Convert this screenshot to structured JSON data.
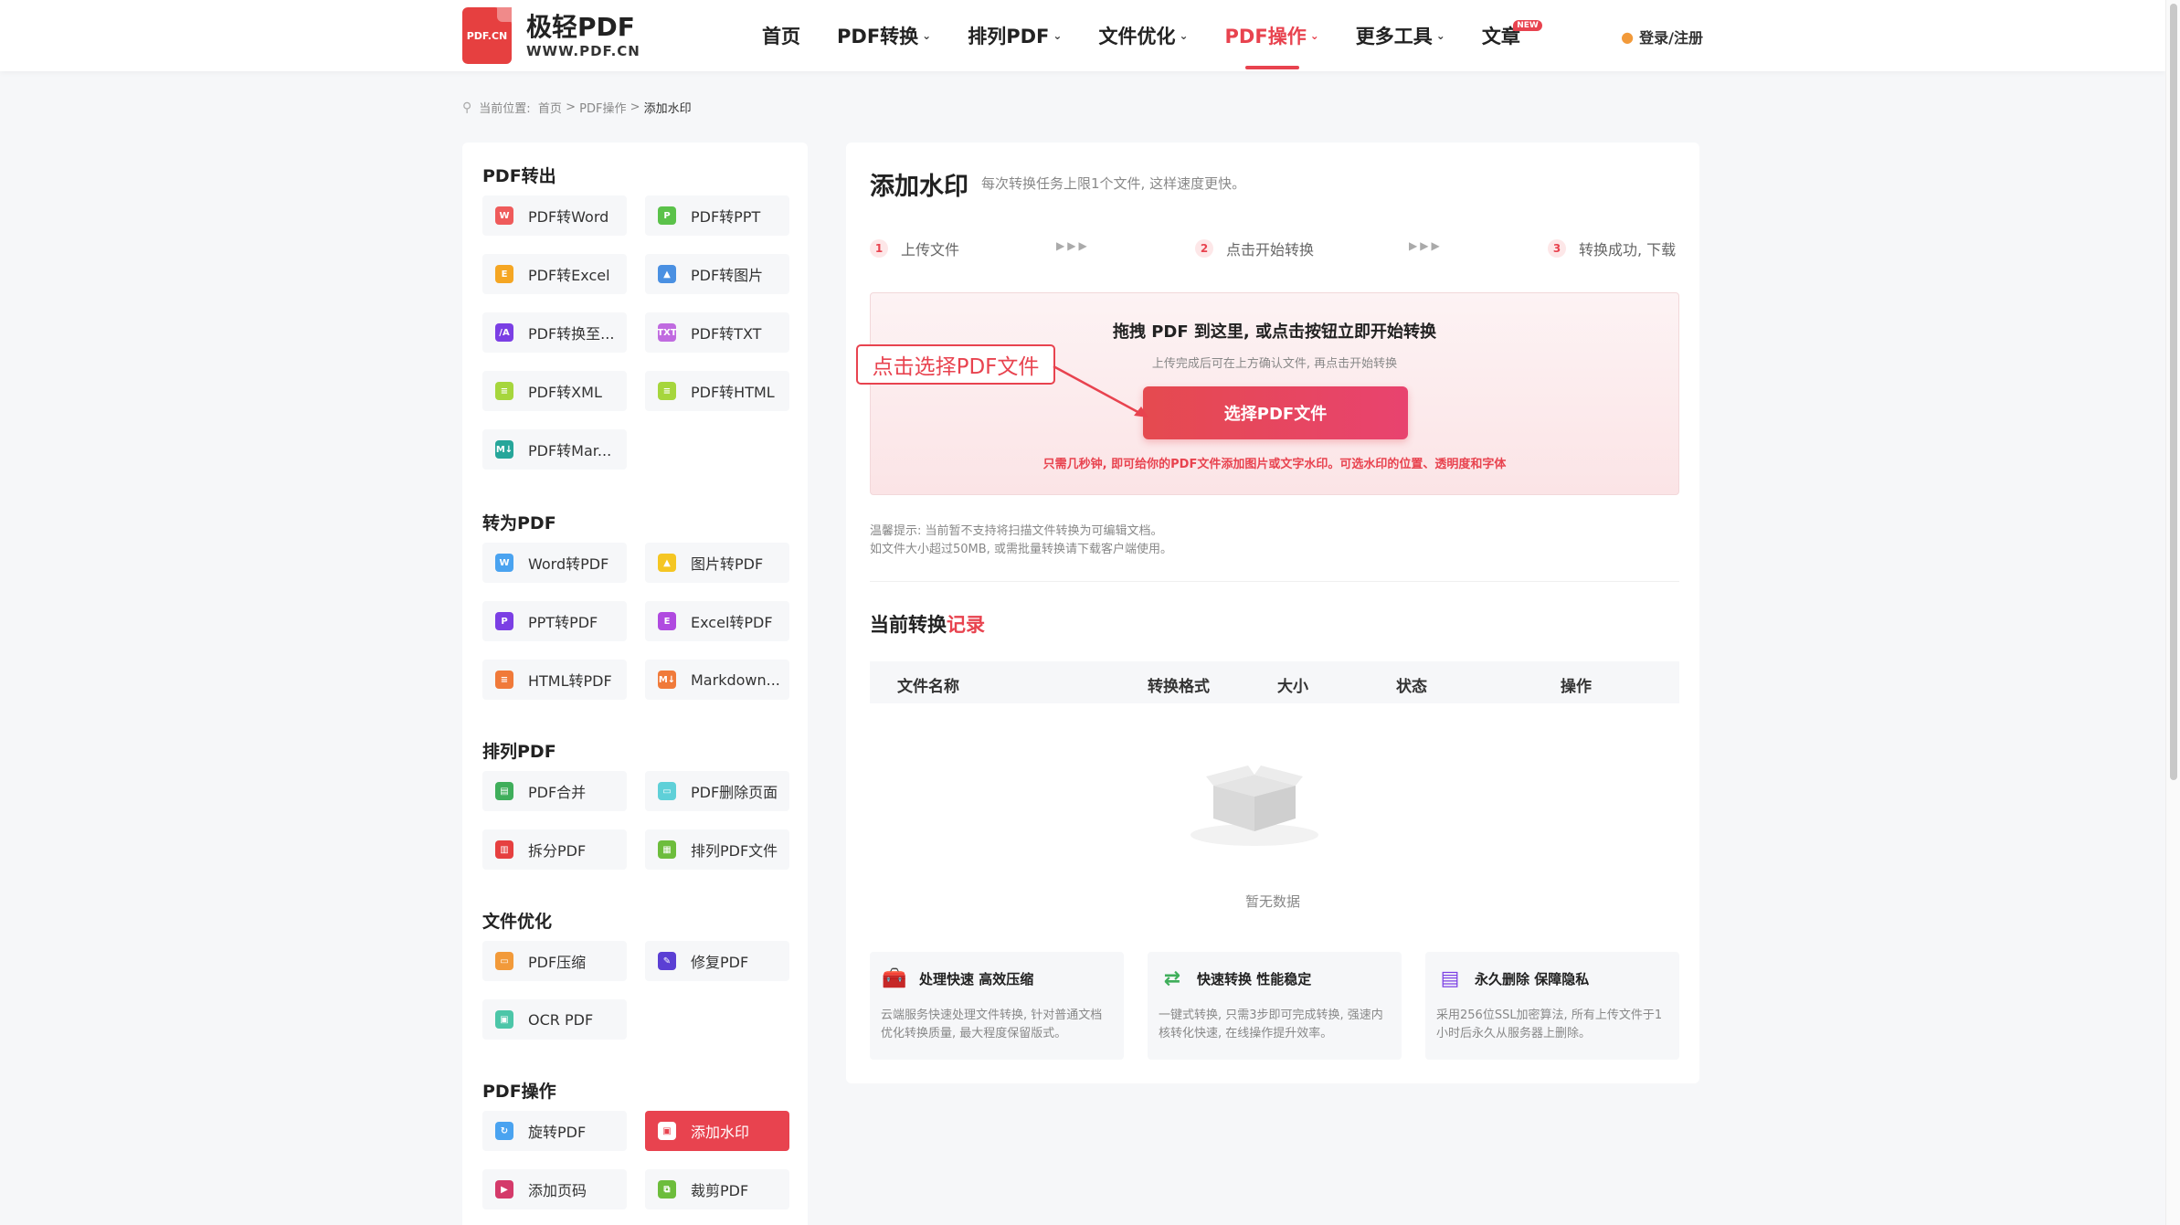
{
  "header": {
    "logo_badge": "PDF.CN",
    "logo_title": "极轻PDF",
    "logo_url": "WWW.PDF.CN",
    "nav": [
      {
        "label": "首页",
        "chevron": false
      },
      {
        "label": "PDF转换",
        "chevron": true
      },
      {
        "label": "排列PDF",
        "chevron": true
      },
      {
        "label": "文件优化",
        "chevron": true
      },
      {
        "label": "PDF操作",
        "chevron": true,
        "active": true
      },
      {
        "label": "更多工具",
        "chevron": true
      },
      {
        "label": "文章",
        "chevron": false,
        "badge": "NEW"
      }
    ],
    "login": "登录/注册"
  },
  "breadcrumb": {
    "prefix": "当前位置:",
    "home": "首页",
    "sep": ">",
    "parent": "PDF操作",
    "current": "添加水印"
  },
  "sidebar": {
    "sections": [
      {
        "title": "PDF转出",
        "tools": [
          {
            "label": "PDF转Word",
            "icon": "W",
            "color": "#ef5b5b"
          },
          {
            "label": "PDF转PPT",
            "icon": "P",
            "color": "#5bc24a"
          },
          {
            "label": "PDF转Excel",
            "icon": "E",
            "color": "#f5a623"
          },
          {
            "label": "PDF转图片",
            "icon": "▲",
            "color": "#4a90e2"
          },
          {
            "label": "PDF转换至...",
            "icon": "/A",
            "color": "#7b3fe4"
          },
          {
            "label": "PDF转TXT",
            "icon": "TXT",
            "color": "#c06be0"
          },
          {
            "label": "PDF转XML",
            "icon": "≡",
            "color": "#a6d63d"
          },
          {
            "label": "PDF转HTML",
            "icon": "≡",
            "color": "#a6d63d"
          },
          {
            "label": "PDF转Mar...",
            "icon": "M↓",
            "color": "#26a69a"
          }
        ]
      },
      {
        "title": "转为PDF",
        "tools": [
          {
            "label": "Word转PDF",
            "icon": "W",
            "color": "#4aa3f0"
          },
          {
            "label": "图片转PDF",
            "icon": "▲",
            "color": "#f5c623"
          },
          {
            "label": "PPT转PDF",
            "icon": "P",
            "color": "#7b3fe4"
          },
          {
            "label": "Excel转PDF",
            "icon": "E",
            "color": "#b04ae0"
          },
          {
            "label": "HTML转PDF",
            "icon": "≡",
            "color": "#f07a3a"
          },
          {
            "label": "Markdown...",
            "icon": "M↓",
            "color": "#f07a3a"
          }
        ]
      },
      {
        "title": "排列PDF",
        "tools": [
          {
            "label": "PDF合并",
            "icon": "▤",
            "color": "#3fae5b"
          },
          {
            "label": "PDF删除页面",
            "icon": "▭",
            "color": "#5fd0d8"
          },
          {
            "label": "拆分PDF",
            "icon": "▥",
            "color": "#e64040"
          },
          {
            "label": "排列PDF文件",
            "icon": "▦",
            "color": "#6dbd3c"
          }
        ]
      },
      {
        "title": "文件优化",
        "tools": [
          {
            "label": "PDF压缩",
            "icon": "▭",
            "color": "#f29a3a"
          },
          {
            "label": "修复PDF",
            "icon": "✎",
            "color": "#5b3fd4"
          },
          {
            "label": "OCR PDF",
            "icon": "▣",
            "color": "#4cc6a8"
          }
        ]
      },
      {
        "title": "PDF操作",
        "tools": [
          {
            "label": "旋转PDF",
            "icon": "↻",
            "color": "#4aa3f0"
          },
          {
            "label": "添加水印",
            "icon": "▣",
            "color": "#4cc68a",
            "active": true
          },
          {
            "label": "添加页码",
            "icon": "▶",
            "color": "#d43a6a"
          },
          {
            "label": "裁剪PDF",
            "icon": "⧉",
            "color": "#6dbd3c"
          }
        ]
      }
    ]
  },
  "main": {
    "title": "添加水印",
    "subtitle": "每次转换任务上限1个文件, 这样速度更快。",
    "steps": [
      {
        "num": "1",
        "label": "上传文件"
      },
      {
        "num": "2",
        "label": "点击开始转换"
      },
      {
        "num": "3",
        "label": "转换成功, 下载"
      }
    ],
    "step_arrows": "▶▶▶",
    "upload": {
      "title": "拖拽 PDF 到这里, 或点击按钮立即开始转换",
      "subtitle": "上传完成后可在上方确认文件, 再点击开始转换",
      "button": "选择PDF文件",
      "note": "只需几秒钟, 即可给你的PDF文件添加图片或文字水印。可选水印的位置、透明度和字体",
      "callout": "点击选择PDF文件"
    },
    "tips": [
      "温馨提示: 当前暂不支持将扫描文件转换为可编辑文档。",
      "如文件大小超过50MB, 或需批量转换请下载客户端使用。"
    ],
    "records": {
      "title_main": "当前转换",
      "title_highlight": "记录",
      "columns": [
        "文件名称",
        "转换格式",
        "大小",
        "状态",
        "操作"
      ],
      "empty": "暂无数据"
    },
    "features": [
      {
        "title": "处理快速 高效压缩",
        "icon": "toolbox-icon",
        "desc": "云端服务快速处理文件转换, 针对普通文档优化转换质量, 最大程度保留版式。"
      },
      {
        "title": "快速转换 性能稳定",
        "icon": "transfer-icon",
        "desc": "一键式转换, 只需3步即可完成转换, 强速内核转化快速, 在线操作提升效率。"
      },
      {
        "title": "永久删除 保障隐私",
        "icon": "shield-doc-icon",
        "desc": "采用256位SSL加密算法, 所有上传文件于1小时后永久从服务器上删除。"
      }
    ]
  },
  "colors": {
    "accent": "#e8434f",
    "bg": "#f6f7f9"
  }
}
